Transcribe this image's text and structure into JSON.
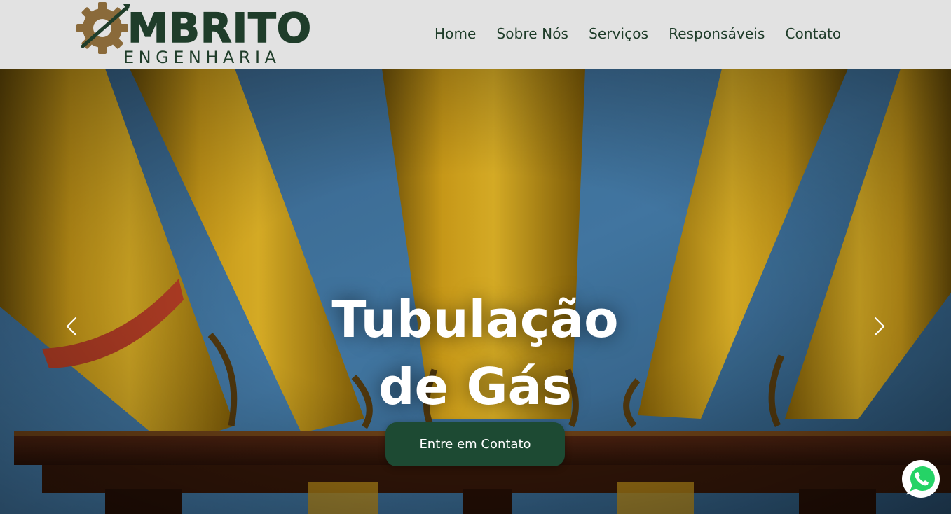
{
  "header": {
    "logo": {
      "brand_text": "MBRITO",
      "tagline": "ENGENHARIA",
      "primary_color": "#1f3d2a",
      "gear_color": "#8a6a3a"
    },
    "nav": [
      {
        "label": "Home"
      },
      {
        "label": "Sobre Nós"
      },
      {
        "label": "Serviços"
      },
      {
        "label": "Responsáveis"
      },
      {
        "label": "Contato"
      }
    ]
  },
  "hero": {
    "title_line1": "Tubulação",
    "title_line2": "de Gás",
    "cta_label": "Entre em Contato",
    "cta_color": "#1d4a33",
    "background_icon": "yellow-gas-pipes-photo"
  },
  "carousel": {
    "prev_icon": "chevron-left-icon",
    "next_icon": "chevron-right-icon"
  },
  "floating": {
    "whatsapp_icon": "whatsapp-icon",
    "whatsapp_color": "#25d366"
  }
}
